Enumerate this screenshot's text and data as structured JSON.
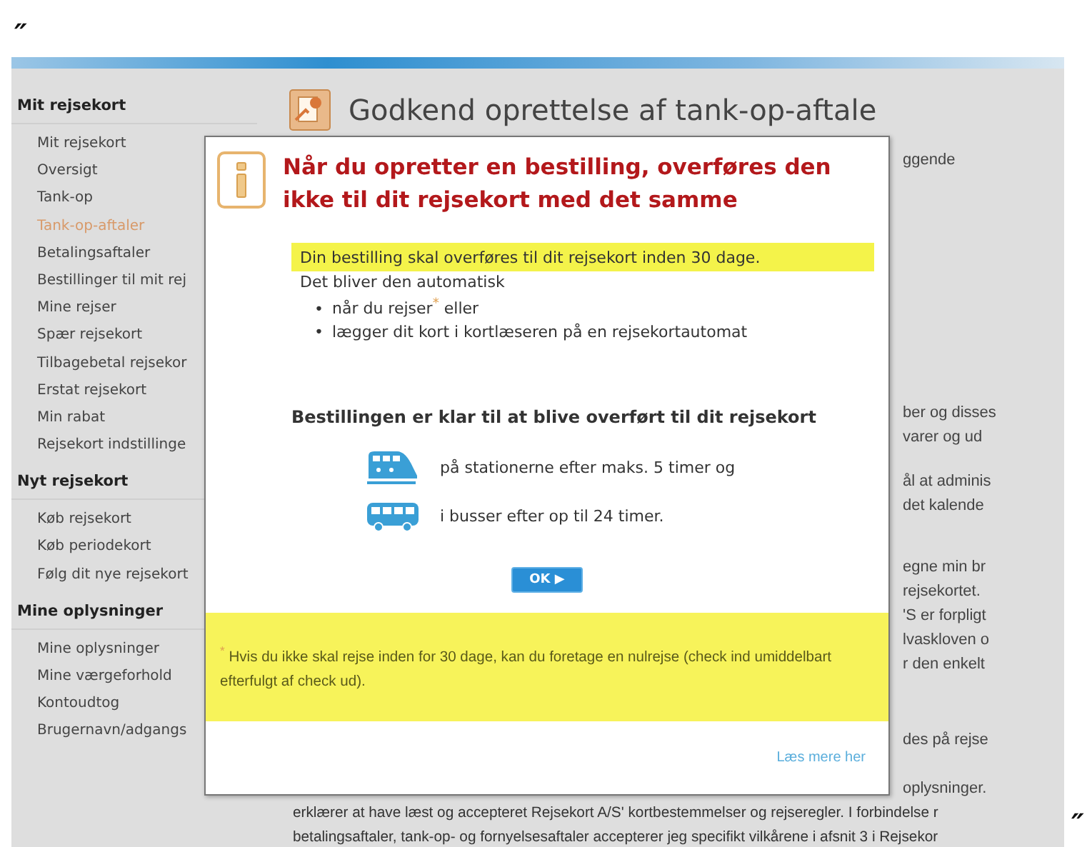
{
  "top_mark": "″",
  "bottom_mark": "″",
  "sidebar": {
    "sections": [
      {
        "heading": "Mit rejsekort",
        "items": [
          {
            "label": "Mit rejsekort",
            "selected": false
          },
          {
            "label": "Oversigt",
            "selected": false
          },
          {
            "label": "Tank-op",
            "selected": false
          },
          {
            "label": "Tank-op-aftaler",
            "selected": true
          },
          {
            "label": "Betalingsaftaler",
            "selected": false
          },
          {
            "label": "Bestillinger til mit rej",
            "selected": false
          },
          {
            "label": "Mine rejser",
            "selected": false
          },
          {
            "label": "Spær rejsekort",
            "selected": false
          },
          {
            "label": "Tilbagebetal rejsekor",
            "selected": false
          },
          {
            "label": "Erstat rejsekort",
            "selected": false
          },
          {
            "label": "Min rabat",
            "selected": false
          },
          {
            "label": "Rejsekort indstillinge",
            "selected": false
          }
        ]
      },
      {
        "heading": "Nyt rejsekort",
        "items": [
          {
            "label": "Køb rejsekort",
            "selected": false
          },
          {
            "label": "Køb periodekort",
            "selected": false
          },
          {
            "label": "Følg dit nye rejsekort",
            "selected": false
          }
        ]
      },
      {
        "heading": "Mine oplysninger",
        "items": [
          {
            "label": "Mine oplysninger",
            "selected": false
          },
          {
            "label": "Mine værgeforhold",
            "selected": false
          },
          {
            "label": "Kontoudtog",
            "selected": false
          },
          {
            "label": "Brugernavn/adgangs",
            "selected": false
          }
        ]
      }
    ]
  },
  "page": {
    "title": "Godkend oprettelse af tank-op-aftale",
    "fragments": [
      [
        "ggende"
      ],
      [
        "ber og disses",
        "varer og ud"
      ],
      [
        "ål at adminis",
        "det kalende"
      ],
      [
        "egne min br",
        "rejsekortet.",
        "'S er forpligt",
        "lvaskloven o",
        "r den enkelt"
      ],
      [
        "des på rejse"
      ],
      [
        "oplysninger."
      ]
    ],
    "bottom_lines": [
      "erklærer at have læst og accepteret Rejsekort A/S' kortbestemmelser og rejseregler. I forbindelse r",
      "betalingsaftaler, tank-op- og fornyelsesaftaler accepterer jeg specifikt vilkårene i afsnit 3 i Rejsekor"
    ]
  },
  "dialog": {
    "title": "Når du opretter en bestilling, overføres den ikke til dit rejsekort med det samme",
    "highlight": "Din bestilling skal overføres til dit rejsekort inden 30 dage.",
    "intro": "Det bliver den automatisk",
    "bullets": [
      {
        "marker": "•",
        "text": "når du rejser$^{*}$ eller"
      },
      {
        "marker": "•",
        "text": "lægger dit kort i kortlæseren på en rejsekortautomat"
      }
    ],
    "subtitle": "Bestillingen er klar til at blive overført til dit rejsekort",
    "modes": [
      {
        "kind": "train",
        "text": "på stationerne efter maks. 5 timer og"
      },
      {
        "kind": "bus",
        "text": "i busser efter op til 24 timer."
      }
    ],
    "ok_button": "OK ▶",
    "footnote": "$^{*}$ Hvis du ikke skal rejse inden for 30 dage, kan du foretage en nulrejse (check ind umiddelbart efterfulgt af check ud).",
    "link": "Læs mere her"
  }
}
